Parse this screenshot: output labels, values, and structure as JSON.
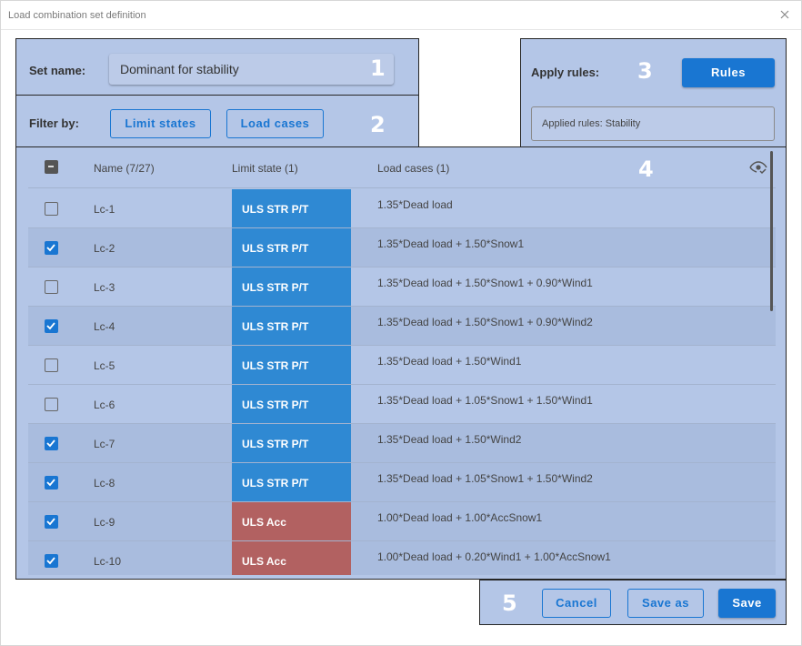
{
  "window": {
    "title": "Load combination set definition"
  },
  "set_name": {
    "label": "Set name:",
    "value": "Dominant for stability",
    "marker": "1"
  },
  "filter": {
    "label": "Filter by:",
    "limit_states": "Limit states",
    "load_cases": "Load cases",
    "marker": "2"
  },
  "apply_rules": {
    "label": "Apply rules:",
    "button": "Rules",
    "applied": "Applied rules: Stability",
    "marker": "3"
  },
  "table": {
    "marker": "4",
    "headers": {
      "name": "Name (7/27)",
      "limit_state": "Limit state (1)",
      "load_cases": "Load cases (1)"
    },
    "rows": [
      {
        "name": "Lc-1",
        "checked": false,
        "limit_state": "ULS STR P/T",
        "kind": "str",
        "load_cases": "1.35*Dead load"
      },
      {
        "name": "Lc-2",
        "checked": true,
        "limit_state": "ULS STR P/T",
        "kind": "str",
        "load_cases": "1.35*Dead load + 1.50*Snow1"
      },
      {
        "name": "Lc-3",
        "checked": false,
        "limit_state": "ULS STR P/T",
        "kind": "str",
        "load_cases": "1.35*Dead load + 1.50*Snow1 + 0.90*Wind1"
      },
      {
        "name": "Lc-4",
        "checked": true,
        "limit_state": "ULS STR P/T",
        "kind": "str",
        "load_cases": "1.35*Dead load + 1.50*Snow1 + 0.90*Wind2"
      },
      {
        "name": "Lc-5",
        "checked": false,
        "limit_state": "ULS STR P/T",
        "kind": "str",
        "load_cases": "1.35*Dead load + 1.50*Wind1"
      },
      {
        "name": "Lc-6",
        "checked": false,
        "limit_state": "ULS STR P/T",
        "kind": "str",
        "load_cases": "1.35*Dead load + 1.05*Snow1 + 1.50*Wind1"
      },
      {
        "name": "Lc-7",
        "checked": true,
        "limit_state": "ULS STR P/T",
        "kind": "str",
        "load_cases": "1.35*Dead load + 1.50*Wind2"
      },
      {
        "name": "Lc-8",
        "checked": true,
        "limit_state": "ULS STR P/T",
        "kind": "str",
        "load_cases": "1.35*Dead load + 1.05*Snow1 + 1.50*Wind2"
      },
      {
        "name": "Lc-9",
        "checked": true,
        "limit_state": "ULS Acc",
        "kind": "acc",
        "load_cases": "1.00*Dead load + 1.00*AccSnow1"
      },
      {
        "name": "Lc-10",
        "checked": true,
        "limit_state": "ULS Acc",
        "kind": "acc",
        "load_cases": "1.00*Dead load + 0.20*Wind1 + 1.00*AccSnow1"
      }
    ]
  },
  "footer": {
    "marker": "5",
    "cancel": "Cancel",
    "save_as": "Save as",
    "save": "Save"
  },
  "colors": {
    "panel": "#b4c6e7",
    "accent": "#1976d2",
    "str": "#2f89d3",
    "acc": "#b26161"
  }
}
